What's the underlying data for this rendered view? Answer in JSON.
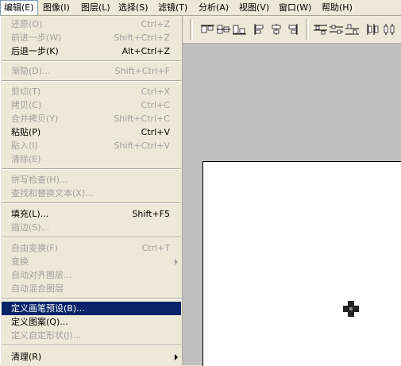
{
  "menubar": {
    "items": [
      {
        "label": "编辑(E)"
      },
      {
        "label": "图像(I)"
      },
      {
        "label": "图层(L)"
      },
      {
        "label": "选择(S)"
      },
      {
        "label": "滤镜(T)"
      },
      {
        "label": "分析(A)"
      },
      {
        "label": "视图(V)"
      },
      {
        "label": "窗口(W)"
      },
      {
        "label": "帮助(H)"
      }
    ]
  },
  "edit_menu": {
    "items": [
      {
        "label": "还原(O)",
        "shortcut": "Ctrl+Z",
        "state": "disabled"
      },
      {
        "label": "前进一步(W)",
        "shortcut": "Shift+Ctrl+Z",
        "state": "disabled"
      },
      {
        "label": "后退一步(K)",
        "shortcut": "Alt+Ctrl+Z",
        "state": "enabled"
      },
      {
        "label": "渐隐(D)...",
        "shortcut": "Shift+Ctrl+F",
        "state": "disabled"
      },
      {
        "label": "剪切(T)",
        "shortcut": "Ctrl+X",
        "state": "disabled"
      },
      {
        "label": "拷贝(C)",
        "shortcut": "Ctrl+C",
        "state": "disabled"
      },
      {
        "label": "合并拷贝(Y)",
        "shortcut": "Shift+Ctrl+C",
        "state": "disabled"
      },
      {
        "label": "粘贴(P)",
        "shortcut": "Ctrl+V",
        "state": "enabled"
      },
      {
        "label": "贴入(I)",
        "shortcut": "Shift+Ctrl+V",
        "state": "disabled"
      },
      {
        "label": "清除(E)",
        "shortcut": "",
        "state": "disabled"
      },
      {
        "label": "拼写检查(H)...",
        "shortcut": "",
        "state": "disabled"
      },
      {
        "label": "查找和替换文本(X)...",
        "shortcut": "",
        "state": "disabled"
      },
      {
        "label": "填充(L)...",
        "shortcut": "Shift+F5",
        "state": "enabled"
      },
      {
        "label": "描边(S)...",
        "shortcut": "",
        "state": "disabled"
      },
      {
        "label": "自由变换(F)",
        "shortcut": "Ctrl+T",
        "state": "disabled"
      },
      {
        "label": "变换",
        "shortcut": "",
        "state": "disabled"
      },
      {
        "label": "自动对齐图层...",
        "shortcut": "",
        "state": "disabled"
      },
      {
        "label": "自动混合图层",
        "shortcut": "",
        "state": "disabled"
      },
      {
        "label": "定义画笔预设(B)...",
        "shortcut": "",
        "state": "highlighted"
      },
      {
        "label": "定义图案(Q)...",
        "shortcut": "",
        "state": "enabled"
      },
      {
        "label": "定义自定形状(J)...",
        "shortcut": "",
        "state": "disabled"
      },
      {
        "label": "清理(R)",
        "shortcut": "",
        "state": "enabled"
      }
    ]
  },
  "colors": {
    "menu_bg": "#ECE9D8",
    "highlight": "#0A246A",
    "disabled_text": "#A0A0A0",
    "workspace": "#C0C0C0",
    "canvas": "#FFFFFF"
  }
}
